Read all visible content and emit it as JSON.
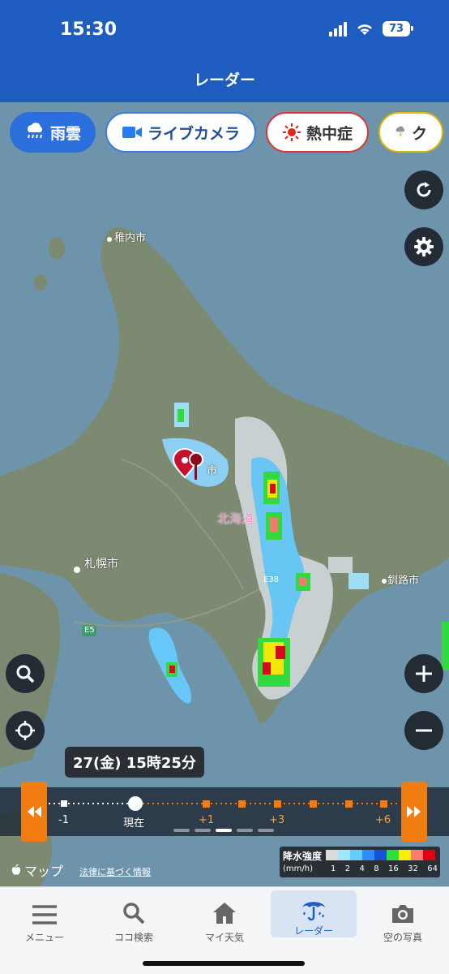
{
  "status_bar": {
    "time": "15:30",
    "battery": "73"
  },
  "header": {
    "title": "レーダー"
  },
  "chips": [
    {
      "label": "雨雲",
      "icon": "rain-cloud-icon"
    },
    {
      "label": "ライブカメラ",
      "icon": "video-camera-icon"
    },
    {
      "label": "熱中症",
      "icon": "sun-icon"
    },
    {
      "label": "ク",
      "icon": "thunder-cloud-icon"
    }
  ],
  "map": {
    "places": {
      "wakkanai": "稚内市",
      "sapporo": "札幌市",
      "kushiro": "釧路市",
      "hokkaido": "北海道",
      "shi": "市"
    },
    "roads": {
      "e38": "E38",
      "e5": "E5"
    },
    "attribution": "マップ",
    "terms": "法律に基づく情報"
  },
  "time_label": "27(金) 15時25分",
  "timeline": {
    "labels": {
      "minus1": "-1",
      "now": "現在",
      "plus1": "+1",
      "plus3": "+3",
      "plus6": "+6"
    },
    "page_count": 5,
    "active_page": 2
  },
  "legend": {
    "title": "降水強度",
    "unit": "(mm/h)",
    "ticks": [
      "1",
      "2",
      "4",
      "8",
      "16",
      "32",
      "64"
    ],
    "colors": [
      "#dcdcdc",
      "#a0e6ff",
      "#66ccff",
      "#2f8bff",
      "#1a52d6",
      "#2ee03a",
      "#ffee00",
      "#ff7a70",
      "#e00012"
    ]
  },
  "tabs": [
    {
      "label": "メニュー",
      "icon": "menu-icon"
    },
    {
      "label": "ココ検索",
      "icon": "search-icon"
    },
    {
      "label": "マイ天気",
      "icon": "home-icon"
    },
    {
      "label": "レーダー",
      "icon": "umbrella-icon"
    },
    {
      "label": "空の写真",
      "icon": "camera-icon"
    }
  ],
  "colors": {
    "accent": "#1e5cc0",
    "timeline_orange": "#f07c12"
  }
}
